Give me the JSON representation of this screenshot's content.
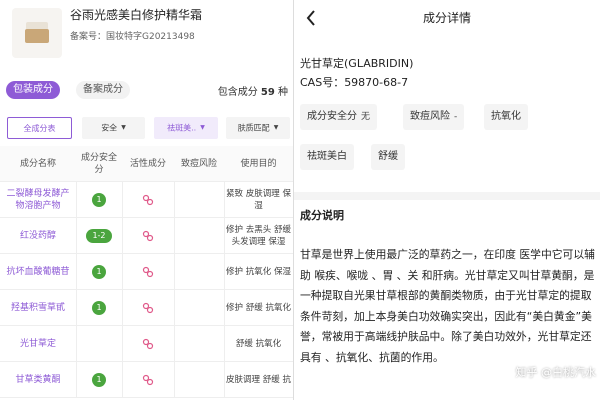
{
  "product": {
    "name": "谷雨光感美白修护精华霜",
    "reg": "备案号：国妆特字G20213498"
  },
  "tabs": {
    "packaging": "包装成分",
    "filing": "备案成分"
  },
  "count": {
    "prefix": "包含成分",
    "value": "59",
    "suffix": "种"
  },
  "filters": {
    "all": "全成分表",
    "safety": "安全",
    "whitening": "祛斑美..",
    "skin": "肤质匹配"
  },
  "table": {
    "headers": {
      "name": "成分名称",
      "safe": "成分安全分",
      "active": "活性成分",
      "acne": "致痘风险",
      "use": "使用目的"
    },
    "rows": [
      {
        "name": "二裂酵母发酵产物溶胞产物",
        "safe": "1",
        "active": true,
        "acne": "",
        "use": "紧致 皮肤调理 保湿"
      },
      {
        "name": "红没药醇",
        "safe": "1-2",
        "active": true,
        "acne": "",
        "use": "修护 去黑头 舒缓 头发调理 保湿"
      },
      {
        "name": "抗坏血酸葡糖苷",
        "safe": "1",
        "active": true,
        "acne": "",
        "use": "修护 抗氧化 保湿"
      },
      {
        "name": "羟基积雪草甙",
        "safe": "1",
        "active": true,
        "acne": "",
        "use": "修护 舒缓 抗氧化"
      },
      {
        "name": "光甘草定",
        "safe": "",
        "active": true,
        "acne": "",
        "use": "舒缓 抗氧化"
      },
      {
        "name": "甘草类黄酮",
        "safe": "1",
        "active": true,
        "acne": "",
        "use": "皮肤调理 舒缓 抗"
      }
    ]
  },
  "detail": {
    "title": "成分详情",
    "ingredient": "光甘草定(GLABRIDIN)",
    "cas": "CAS号：59870-68-7",
    "chips": {
      "safety_label": "成分安全分",
      "safety_value": "无",
      "acne_label": "致痘风险",
      "acne_value": "-",
      "antiox": "抗氧化",
      "whitening": "祛斑美白",
      "soothing": "舒缓"
    },
    "section_title": "成分说明",
    "description": "甘草是世界上使用最广泛的草药之一，在印度        医学中它可以辅助      喉疾、喉咙      、胃      、关         和肝病。光甘草定又叫甘草黄酮，是一种提取自光果甘草根部的黄酮类物质，由于光甘草定的提取条件苛刻，加上本身美白功效确实突出，因此有“美白黄金”美誉，常被用于高端线护肤品中。除了美白功效外，光甘草定还具有       、抗氧化、抗菌的作用。",
    "watermark": "知乎 @白桃汽水"
  },
  "colors": {
    "accent": "#8e5bd6",
    "safe_green": "#4aa53e",
    "active_icon": "#e05a8a"
  },
  "icons": {
    "back": "back-arrow-icon",
    "active": "active-ingredient-icon"
  }
}
